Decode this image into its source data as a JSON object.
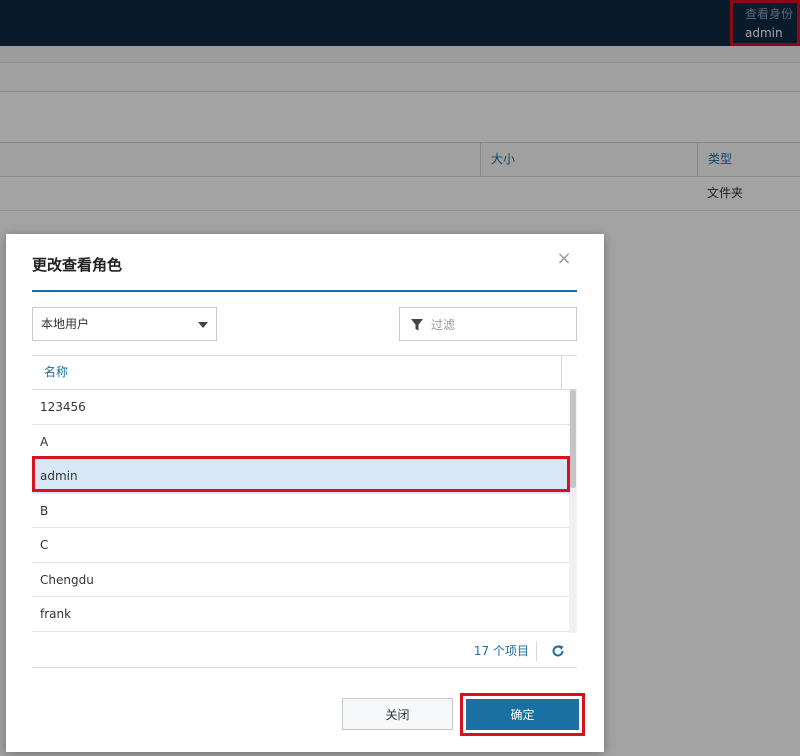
{
  "header": {
    "identity_label": "查看身份",
    "identity_user": "admin"
  },
  "file_grid": {
    "columns": {
      "size": "大小",
      "type": "类型"
    },
    "rows": [
      {
        "type": "文件夹"
      }
    ]
  },
  "dialog": {
    "title": "更改查看角色",
    "close_glyph": "×",
    "source_select": "本地用户",
    "filter_placeholder": "过滤",
    "list_header": "名称",
    "items": [
      "123456",
      "A",
      "admin",
      "B",
      "C",
      "Chengdu",
      "frank"
    ],
    "selected_item": "admin",
    "item_count": "17 个项目",
    "buttons": {
      "close": "关闭",
      "confirm": "确定"
    }
  },
  "colors": {
    "topbar": "#0f2a43",
    "accent": "#1c6ea4",
    "primary_button": "#1a6fa3",
    "selected_row": "#d8e7f6",
    "annotation_red": "#d5121e"
  },
  "icons": [
    "close-icon",
    "chevron-down-icon",
    "filter-icon",
    "refresh-icon"
  ]
}
